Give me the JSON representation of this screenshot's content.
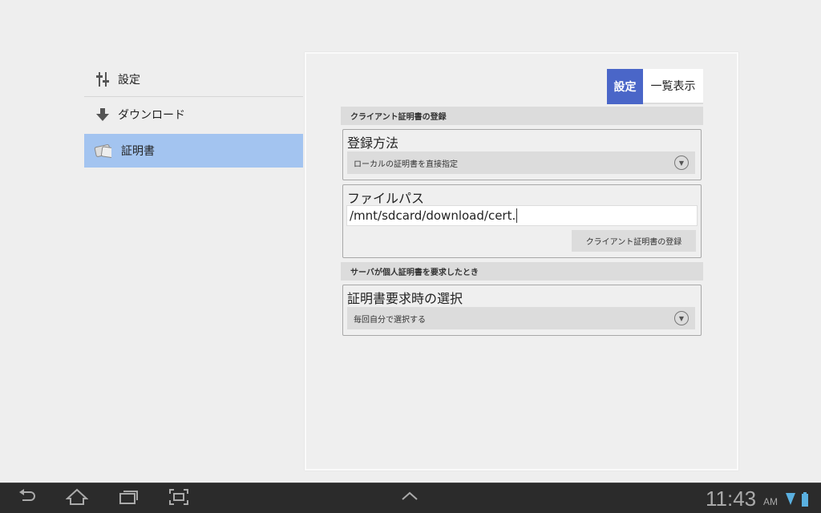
{
  "sidebar": {
    "items": [
      {
        "label": "設定",
        "icon": "sliders-icon"
      },
      {
        "label": "ダウンロード",
        "icon": "download-arrow-icon"
      },
      {
        "label": "証明書",
        "icon": "certificate-icon",
        "selected": true
      }
    ]
  },
  "tabs": {
    "settings": "設定",
    "list": "一覧表示",
    "active_color": "#4a66c8"
  },
  "section1": {
    "header": "クライアント証明書の登録",
    "method": {
      "title": "登録方法",
      "value": "ローカルの証明書を直接指定"
    },
    "filepath": {
      "title": "ファイルパス",
      "value": "/mnt/sdcard/download/cert.",
      "button": "クライアント証明書の登録"
    }
  },
  "section2": {
    "header": "サーバが個人証明書を要求したとき",
    "select": {
      "title": "証明書要求時の選択",
      "value": "毎回自分で選択する"
    }
  },
  "statusbar": {
    "time": "11:43",
    "ampm": "AM"
  }
}
